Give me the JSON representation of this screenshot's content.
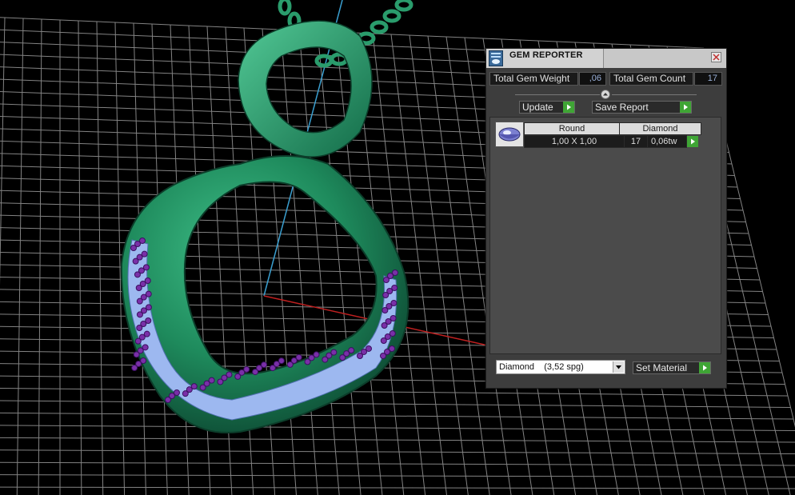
{
  "window": {
    "title": "GEM REPORTER"
  },
  "summary": {
    "total_weight_label": "Total Gem Weight",
    "total_weight_value": ",06",
    "total_count_label": "Total Gem Count",
    "total_count_value": "17"
  },
  "toolbar": {
    "update_label": "Update",
    "save_report_label": "Save Report"
  },
  "gems": {
    "headers": [
      "Round",
      "Diamond"
    ],
    "rows": [
      {
        "size": "1,00 X 1,00",
        "count": "17",
        "weight": "0,06tw"
      }
    ]
  },
  "material": {
    "selected": "Diamond    (3,52 spg)",
    "set_label": "Set Material"
  },
  "colors": {
    "accent_green": "#3fa535",
    "model_green": "#1f8a5f",
    "gem_blue": "#9db8f0",
    "gem_purple": "#7a2fa8"
  },
  "icons": [
    "gem-reporter-app-icon",
    "close-icon",
    "collapse-icon",
    "go-arrow-icon",
    "round-gem-icon",
    "chevron-down-icon"
  ]
}
